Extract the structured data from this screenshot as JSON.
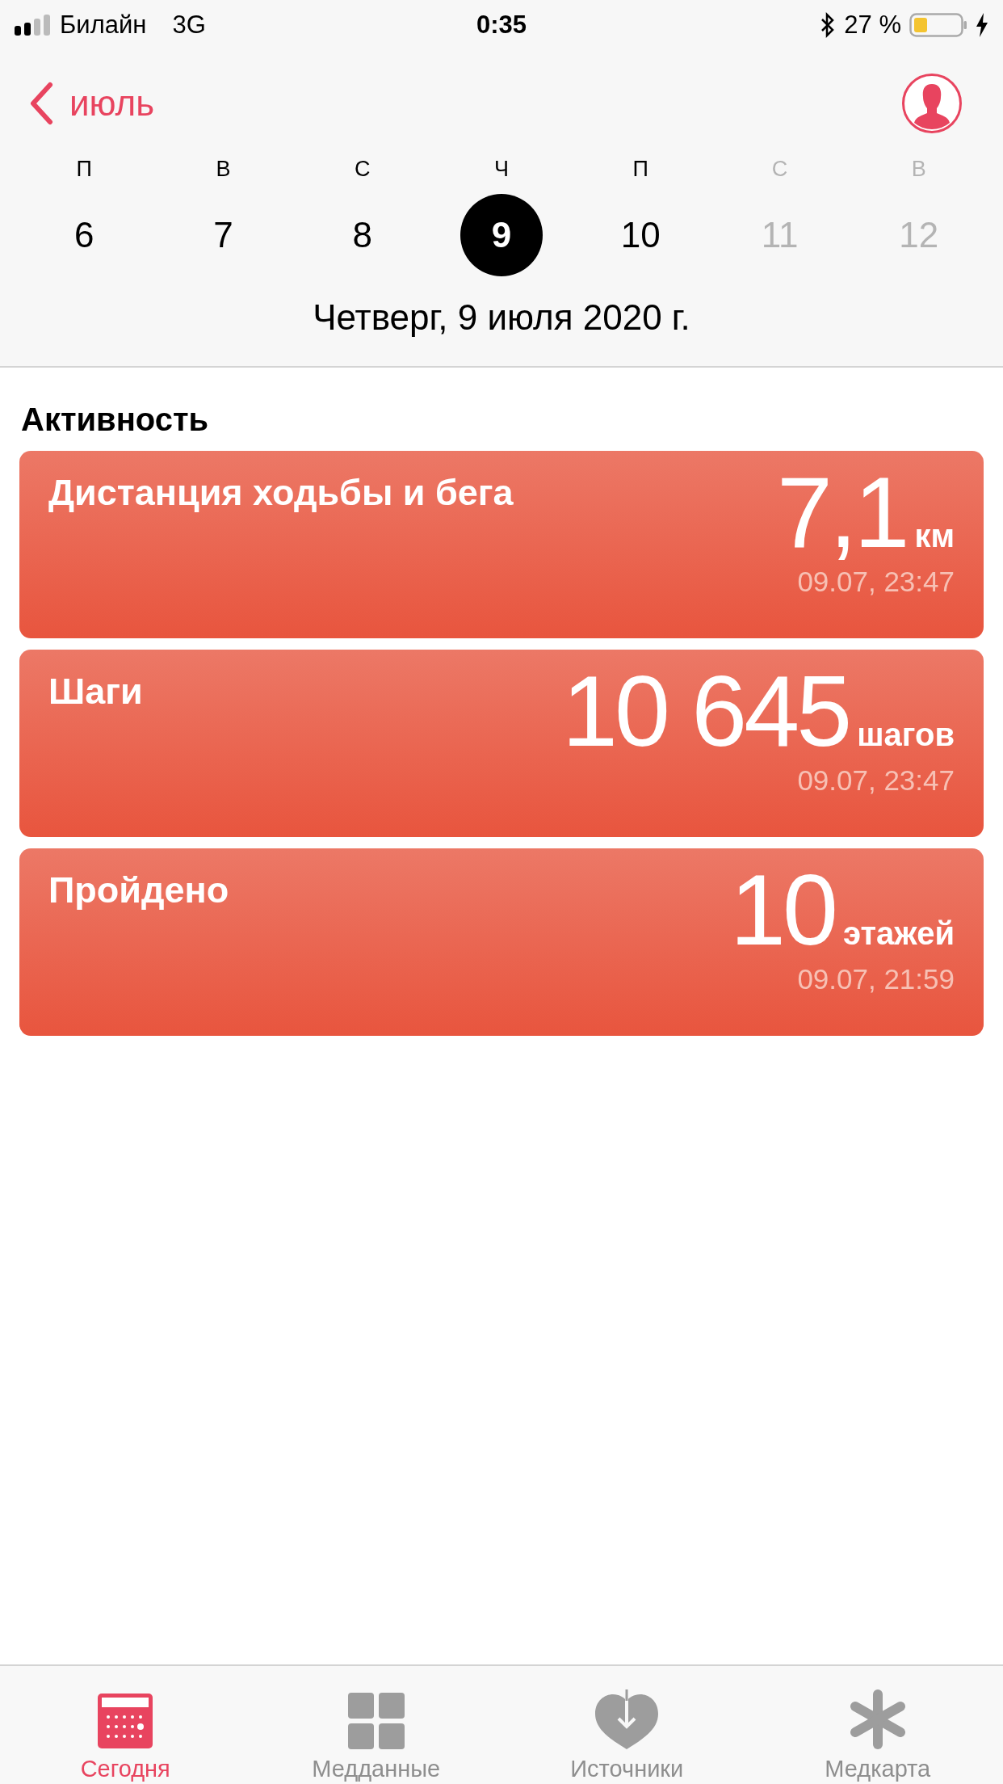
{
  "status_bar": {
    "carrier": "Билайн",
    "network": "3G",
    "time": "0:35",
    "battery_percent": "27 %"
  },
  "nav": {
    "back_label": "июль"
  },
  "week": [
    {
      "weekday": "П",
      "day": "6",
      "selected": false,
      "dimmed": false
    },
    {
      "weekday": "В",
      "day": "7",
      "selected": false,
      "dimmed": false
    },
    {
      "weekday": "С",
      "day": "8",
      "selected": false,
      "dimmed": false
    },
    {
      "weekday": "Ч",
      "day": "9",
      "selected": true,
      "dimmed": false
    },
    {
      "weekday": "П",
      "day": "10",
      "selected": false,
      "dimmed": false
    },
    {
      "weekday": "С",
      "day": "11",
      "selected": false,
      "dimmed": true
    },
    {
      "weekday": "В",
      "day": "12",
      "selected": false,
      "dimmed": true
    }
  ],
  "date_title": "Четверг, 9 июля 2020 г.",
  "section_title": "Активность",
  "cards": [
    {
      "title": "Дистанция ходьбы и бега",
      "value": "7,1",
      "unit": "км",
      "time": "09.07, 23:47"
    },
    {
      "title": "Шаги",
      "value": "10 645",
      "unit": "шагов",
      "time": "09.07, 23:47"
    },
    {
      "title": "Пройдено",
      "value": "10",
      "unit": "этажей",
      "time": "09.07, 21:59"
    }
  ],
  "tab_bar": [
    {
      "label": "Сегодня",
      "kind": "calendar",
      "selected": true
    },
    {
      "label": "Медданные",
      "kind": "grid",
      "selected": false
    },
    {
      "label": "Источники",
      "kind": "heart",
      "selected": false
    },
    {
      "label": "Медкарта",
      "kind": "asterisk",
      "selected": false
    }
  ]
}
